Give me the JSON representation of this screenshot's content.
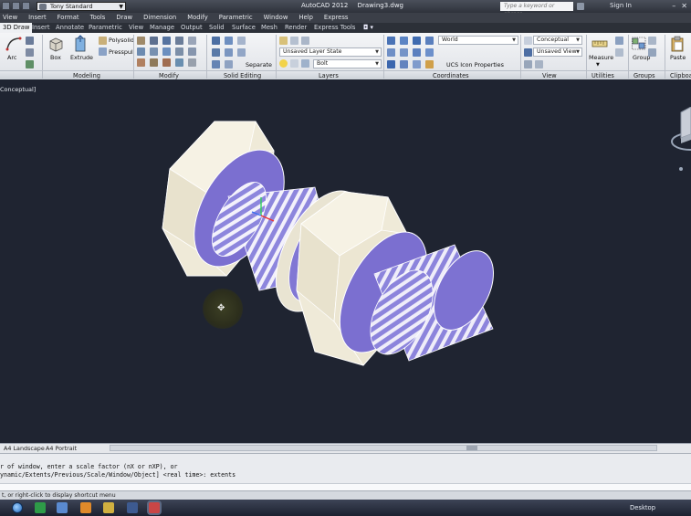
{
  "titlebar": {
    "workspace": "Tony Standard",
    "app_name": "AutoCAD 2012",
    "document": "Drawing3.dwg",
    "search_placeholder": "Type a keyword or phrase",
    "signin": "Sign In"
  },
  "menubar": [
    "View",
    "Insert",
    "Format",
    "Tools",
    "Draw",
    "Dimension",
    "Modify",
    "Parametric",
    "Window",
    "Help",
    "Express"
  ],
  "ribbon_tabs": [
    "3D Draw",
    "Insert",
    "Annotate",
    "Parametric",
    "View",
    "Manage",
    "Output",
    "Solid",
    "Surface",
    "Mesh",
    "Render",
    "Express Tools"
  ],
  "ribbon": {
    "arc": "Arc",
    "box": "Box",
    "extrude": "Extrude",
    "polysolid": "Polysolid",
    "presspull": "Presspull",
    "separate": "Separate",
    "layer_state": "Unsaved Layer State",
    "layer_name": "Bolt",
    "ucs_world": "World",
    "ucs_icon_props": "UCS Icon Properties",
    "visual_style": "Conceptual",
    "view_state": "Unsaved View",
    "measure": "Measure",
    "group": "Group",
    "paste": "Paste"
  },
  "panels": [
    "Modeling",
    "Modify",
    "Solid Editing",
    "Layers",
    "Coordinates",
    "View",
    "Utilities",
    "Groups",
    "Clipboa"
  ],
  "viewport": {
    "label": "Conceptual]"
  },
  "layout_tabs": [
    "A4 Landscape",
    "A4 Portrait"
  ],
  "command": {
    "line1": "r of window, enter a scale factor (nX or nXP), or",
    "line2": "ynamic/Extents/Previous/Scale/Window/Object] <real time>: extents"
  },
  "status": {
    "text": "t, or right-click to display shortcut menu"
  },
  "taskbar": {
    "desktop": "Desktop"
  },
  "colors": {
    "viewport_bg": "#1f2431",
    "hex_face": "#efead8",
    "thread_purple": "#8c84dc",
    "washer_blue": "#7b6fd0"
  }
}
